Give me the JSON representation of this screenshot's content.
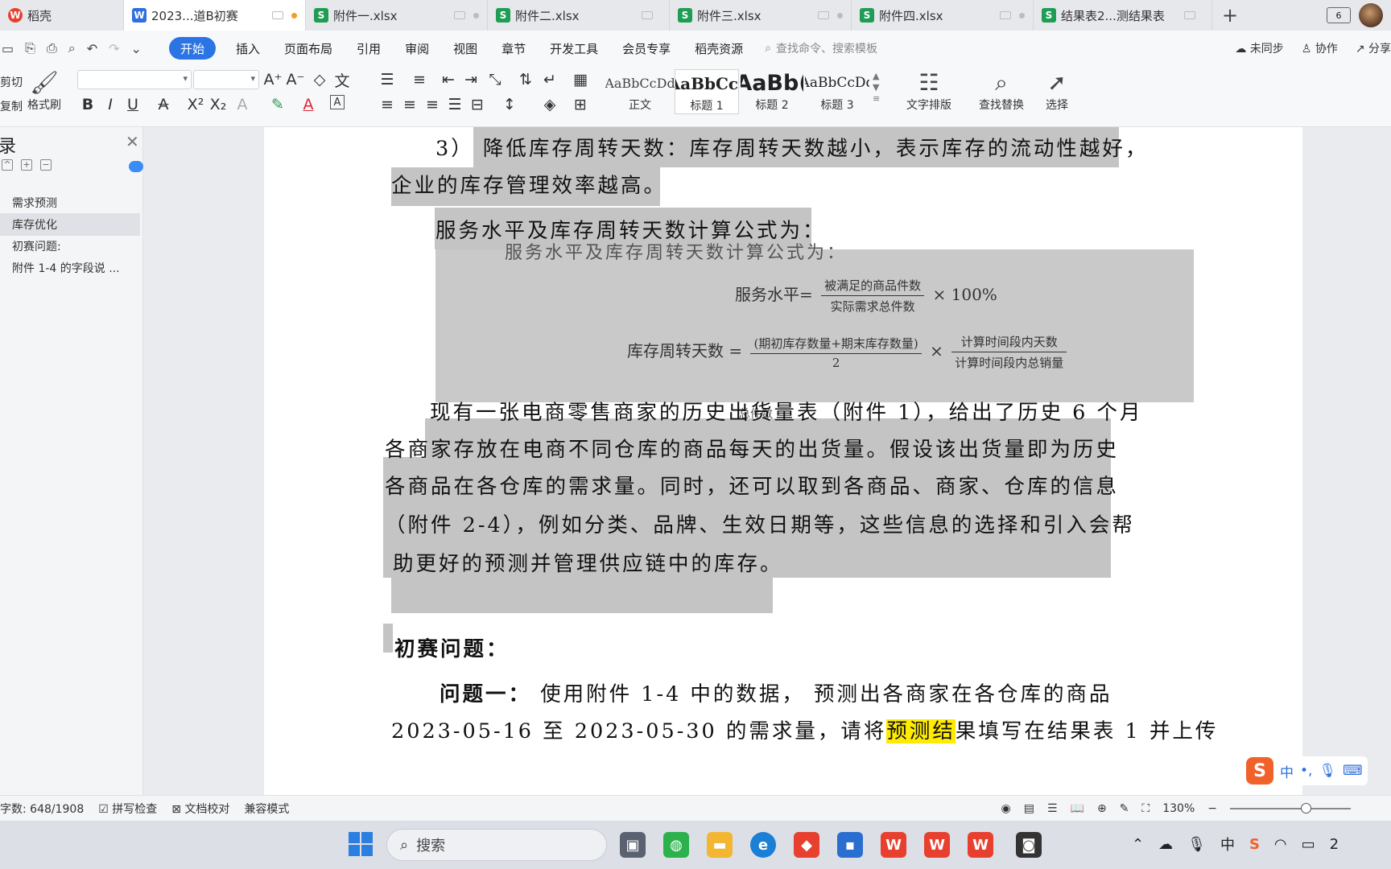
{
  "tabs": [
    {
      "label": "稻壳",
      "icon": "docer-icon"
    },
    {
      "label": "2023...道B初赛",
      "icon": "word-icon"
    },
    {
      "label": "附件一.xlsx",
      "icon": "sheet-icon"
    },
    {
      "label": "附件二.xlsx",
      "icon": "sheet-icon"
    },
    {
      "label": "附件三.xlsx",
      "icon": "sheet-icon"
    },
    {
      "label": "附件四.xlsx",
      "icon": "sheet-icon"
    },
    {
      "label": "结果表2...测结果表",
      "icon": "sheet-icon"
    }
  ],
  "tabbar": {
    "new_tab": "+",
    "window_badge": "6"
  },
  "menu": {
    "items": [
      "开始",
      "插入",
      "页面布局",
      "引用",
      "审阅",
      "视图",
      "章节",
      "开发工具",
      "会员专享",
      "稻壳资源"
    ],
    "search_placeholder": "查找命令、搜索模板",
    "sync": "未同步",
    "collab": "协作",
    "share": "分享"
  },
  "ribbon": {
    "cut": "剪切",
    "copy": "复制",
    "format_painter": "格式刷",
    "styles": [
      {
        "sample": "AaBbCcDd",
        "name": "正文"
      },
      {
        "sample": "AaBbCcI",
        "name": "标题 1"
      },
      {
        "sample": "AaBb(",
        "name": "标题 2"
      },
      {
        "sample": "AaBbCcDd",
        "name": "标题 3"
      }
    ],
    "text_layout": "文字排版",
    "find_replace": "查找替换",
    "select": "选择"
  },
  "outline": {
    "title": "录",
    "items": [
      "需求预测",
      "库存优化",
      "初赛问题:",
      "附件 1-4 的字段说 ..."
    ],
    "selected_index": 1
  },
  "document": {
    "line1": "3） 降低库存周转天数：库存周转天数越小，表示库存的流动性越好，",
    "line2": "企业的库存管理效率越高。",
    "line3": "服务水平及库存周转天数计算公式为：",
    "formula_ghost": "服务水平及库存周转天数计算公式为：",
    "f1_lhs": "服务水平=",
    "f1_num": "被满足的商品件数",
    "f1_den": "实际需求总件数",
    "f1_rhs": "× 100%",
    "f2_lhs": "库存周转天数 =",
    "f2_num": "(期初库存数量+期末库存数量)",
    "f2_den": "2",
    "f2_times": "×",
    "f2_num2": "计算时间段内天数",
    "f2_den2": "计算时间段内总销量",
    "ghost_small": "总件数",
    "para1": "现有一张电商零售商家的历史出货量表（附件 1），给出了历史 6 个月",
    "para2": "各商家存放在电商不同仓库的商品每天的出货量。假设该出货量即为历史",
    "para3": "各商品在各仓库的需求量。同时，还可以取到各商品、商家、仓库的信息",
    "para4": "（附件 2-4），例如分类、品牌、生效日期等，这些信息的选择和引入会帮",
    "para5": "助更好的预测并管理供应链中的库存。",
    "heading": "初赛问题：",
    "q1_label": "问题一：",
    "q1_text": " 使用附件  1-4 中的数据，  预测出各商家在各仓库的商品",
    "q2_pre": "2023-05-16 至 2023-05-30 的需求量，请将",
    "q2_hl": "预测结",
    "q2_post": "果填写在结果表 1 并上传"
  },
  "status": {
    "word_count": "字数: 648/1908",
    "spell_check": "拼写检查",
    "doc_proof": "文档校对",
    "compat_mode": "兼容模式",
    "zoom": "130%"
  },
  "ime": {
    "lang": "中",
    "punct": "•,"
  },
  "taskbar": {
    "search": "搜索",
    "tray_lang": "中",
    "tray_time": "2"
  },
  "colors": {
    "accent": "#2b74e4",
    "selection": "#c4c4c4",
    "highlight": "#ffeb00"
  }
}
